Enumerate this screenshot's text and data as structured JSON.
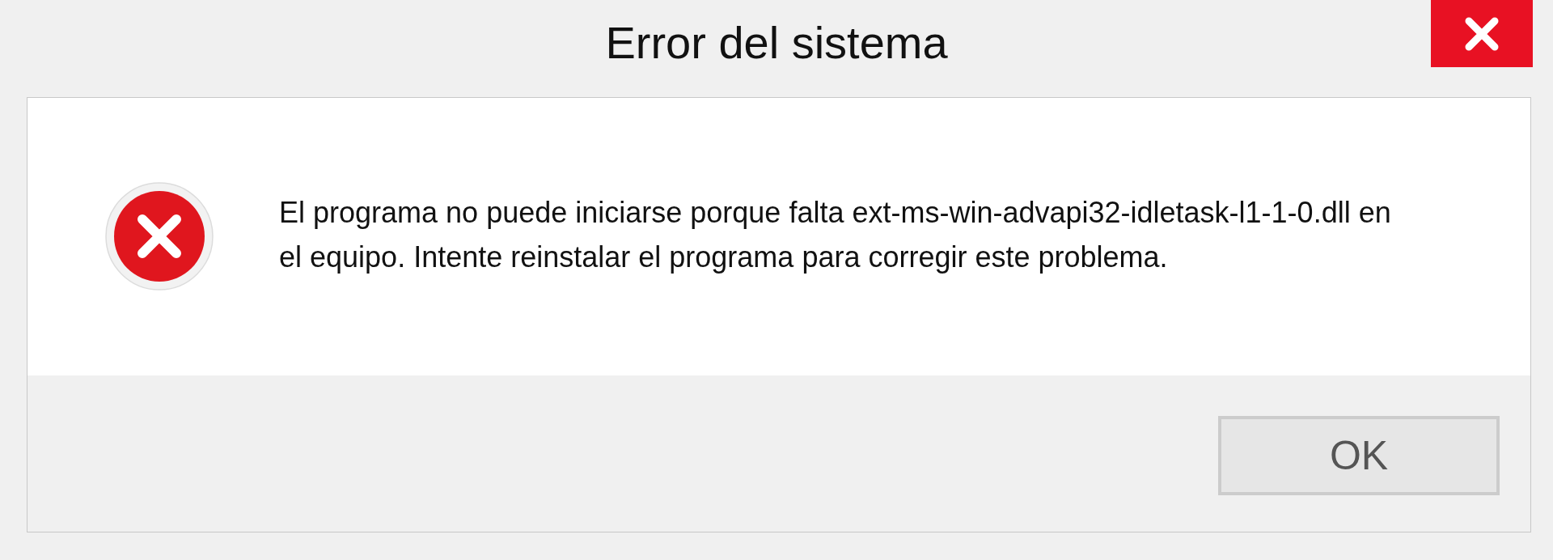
{
  "window": {
    "title": "Error del sistema"
  },
  "message": "El programa no puede iniciarse porque falta ext-ms-win-advapi32-idletask-l1-1-0.dll en el equipo. Intente reinstalar el programa para corregir este problema.",
  "buttons": [
    {
      "label": "OK"
    }
  ]
}
